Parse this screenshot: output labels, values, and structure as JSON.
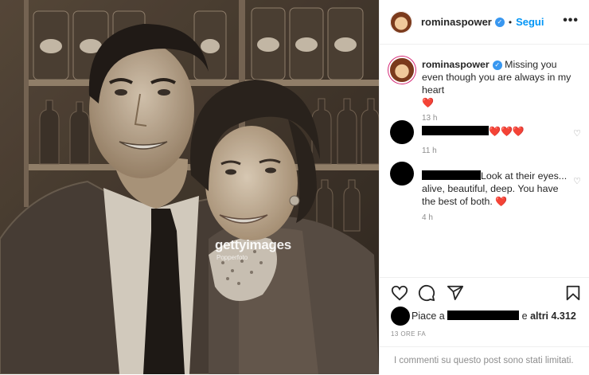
{
  "media": {
    "watermark_brand": "gettyimages",
    "watermark_credit": "Popperfoto"
  },
  "header": {
    "username": "rominaspower",
    "separator": "•",
    "follow_label": "Segui",
    "more_label": "•••"
  },
  "caption": {
    "username": "rominaspower",
    "text": "Missing you even though you are always in my heart",
    "emoji": "❤️",
    "time": "13 h"
  },
  "comments": [
    {
      "hearts": "❤️❤️❤️",
      "time": "11 h"
    },
    {
      "text": "Look at their eyes... alive, beautiful, deep. You have the best of both.",
      "emoji": "❤️",
      "time": "4 h"
    }
  ],
  "likes": {
    "prefix": "Piace a",
    "others": "altri 4.312",
    "conjunction": "e"
  },
  "post_age": "13 ORE FA",
  "comments_limited": "I commenti su questo post sono stati limitati.",
  "icons": {
    "like": "heart-icon",
    "comment": "comment-icon",
    "share": "send-icon",
    "save": "bookmark-icon",
    "verified": "verified-badge-icon",
    "comment_like": "small-heart-icon"
  },
  "colors": {
    "link_blue": "#0095f6",
    "verified_blue": "#3897f0",
    "heart_red": "#ed4956",
    "muted": "#8e8e8e"
  }
}
